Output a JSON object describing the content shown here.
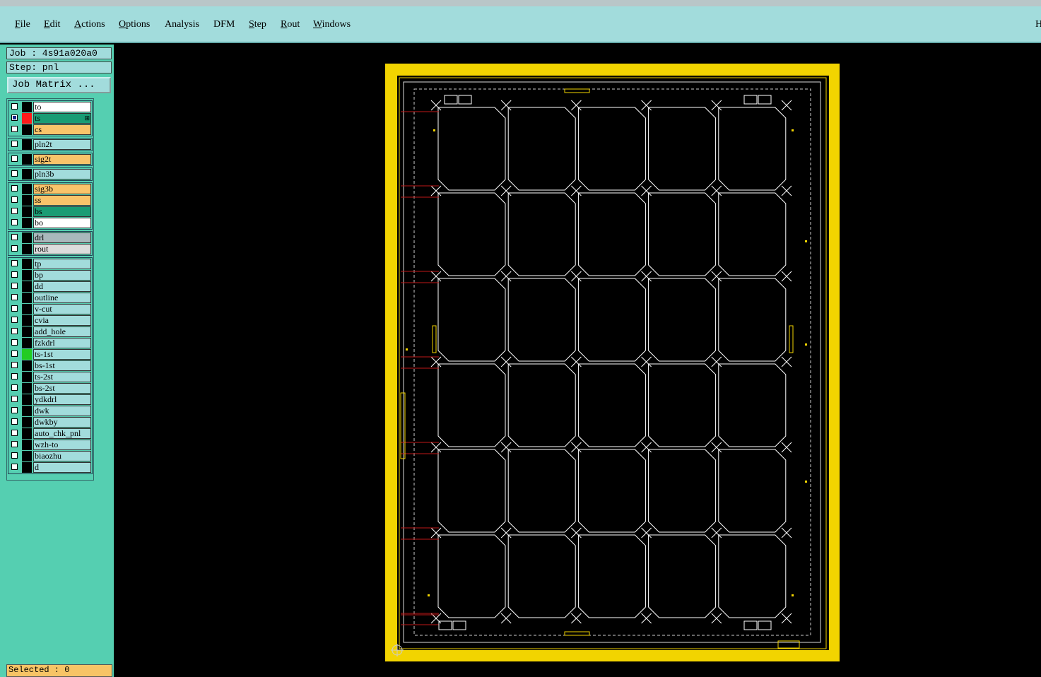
{
  "menu": [
    "File",
    "Edit",
    "Actions",
    "Options",
    "Analysis",
    "DFM",
    "Step",
    "Rout",
    "Windows"
  ],
  "menu_underline_index": [
    0,
    0,
    0,
    0,
    -1,
    -1,
    0,
    0,
    0
  ],
  "menu_right_cut": "H",
  "job_label": "Job : 4s91a020a0",
  "step_label": "Step: pnl",
  "job_matrix_button": "Job Matrix ...",
  "selected_label": "Selected : 0",
  "layers": [
    {
      "name": "to",
      "color": "#ffffff",
      "checked": false,
      "swatch": "#000"
    },
    {
      "name": "ts",
      "color": "#1a9c74",
      "checked": true,
      "swatch": "#ff1a1a",
      "marker": "⊞"
    },
    {
      "name": "cs",
      "color": "#f9c46a",
      "checked": false,
      "swatch": "#000"
    },
    {
      "name": "pln2t",
      "color": "#a2dcdc",
      "checked": false,
      "swatch": "#000"
    },
    {
      "name": "sig2t",
      "color": "#f9c46a",
      "checked": false,
      "swatch": "#000"
    },
    {
      "name": "pln3b",
      "color": "#a2dcdc",
      "checked": false,
      "swatch": "#000"
    },
    {
      "name": "sig3b",
      "color": "#f9c46a",
      "checked": false,
      "swatch": "#000"
    },
    {
      "name": "ss",
      "color": "#f9c46a",
      "checked": false,
      "swatch": "#000"
    },
    {
      "name": "bs",
      "color": "#1a9c74",
      "checked": false,
      "swatch": "#000"
    },
    {
      "name": "bo",
      "color": "#ffffff",
      "checked": false,
      "swatch": "#000"
    },
    {
      "name": "drl",
      "color": "#a9b8bc",
      "checked": false,
      "swatch": "#000"
    },
    {
      "name": "rout",
      "color": "#dcdcdc",
      "checked": false,
      "swatch": "#000"
    },
    {
      "name": "tp",
      "color": "#a2dcdc",
      "checked": false,
      "swatch": "#000"
    },
    {
      "name": "bp",
      "color": "#a2dcdc",
      "checked": false,
      "swatch": "#000"
    },
    {
      "name": "dd",
      "color": "#a2dcdc",
      "checked": false,
      "swatch": "#000"
    },
    {
      "name": "outline",
      "color": "#a2dcdc",
      "checked": false,
      "swatch": "#000"
    },
    {
      "name": "v-cut",
      "color": "#a2dcdc",
      "checked": false,
      "swatch": "#000"
    },
    {
      "name": "cvia",
      "color": "#a2dcdc",
      "checked": false,
      "swatch": "#000"
    },
    {
      "name": "add_hole",
      "color": "#a2dcdc",
      "checked": false,
      "swatch": "#000"
    },
    {
      "name": "fzkdrl",
      "color": "#a2dcdc",
      "checked": false,
      "swatch": "#000"
    },
    {
      "name": "ts-1st",
      "color": "#a2dcdc",
      "checked": false,
      "swatch": "#22cc22"
    },
    {
      "name": "bs-1st",
      "color": "#a2dcdc",
      "checked": false,
      "swatch": "#000"
    },
    {
      "name": "ts-2st",
      "color": "#a2dcdc",
      "checked": false,
      "swatch": "#000"
    },
    {
      "name": "bs-2st",
      "color": "#a2dcdc",
      "checked": false,
      "swatch": "#000"
    },
    {
      "name": "ydkdrl",
      "color": "#a2dcdc",
      "checked": false,
      "swatch": "#000"
    },
    {
      "name": "dwk",
      "color": "#a2dcdc",
      "checked": false,
      "swatch": "#000"
    },
    {
      "name": "dwkby",
      "color": "#a2dcdc",
      "checked": false,
      "swatch": "#000"
    },
    {
      "name": "auto_chk_pnl",
      "color": "#a2dcdc",
      "checked": false,
      "swatch": "#000"
    },
    {
      "name": "wzh-to",
      "color": "#a2dcdc",
      "checked": false,
      "swatch": "#000"
    },
    {
      "name": "biaozhu",
      "color": "#a2dcdc",
      "checked": false,
      "swatch": "#000"
    },
    {
      "name": "d",
      "color": "#a2dcdc",
      "checked": false,
      "swatch": "#000"
    }
  ],
  "panel": {
    "rows": 6,
    "cols": 5,
    "frame_color": "#f2d400",
    "line_color": "#ffffff"
  }
}
